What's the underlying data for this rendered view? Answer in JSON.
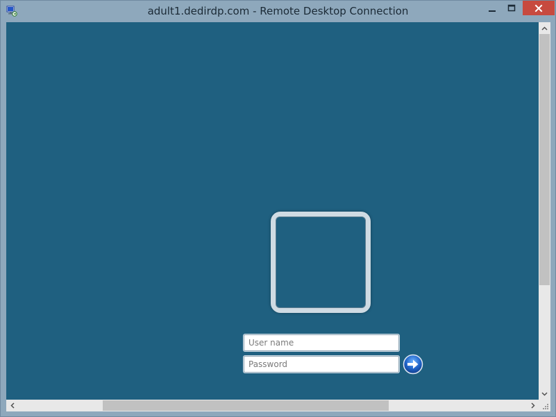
{
  "window": {
    "title": "adult1.dedirdp.com - Remote Desktop Connection"
  },
  "icons": {
    "app": "remote-desktop-icon",
    "minimize": "minimize-icon",
    "maximize": "maximize-icon",
    "close": "close-icon",
    "submit": "arrow-right-icon"
  },
  "login": {
    "username_placeholder": "User name",
    "password_placeholder": "Password"
  },
  "colors": {
    "desktop_bg": "#1f6080",
    "titlebar_bg": "#8ea8bc",
    "close_button": "#c74a3f"
  }
}
